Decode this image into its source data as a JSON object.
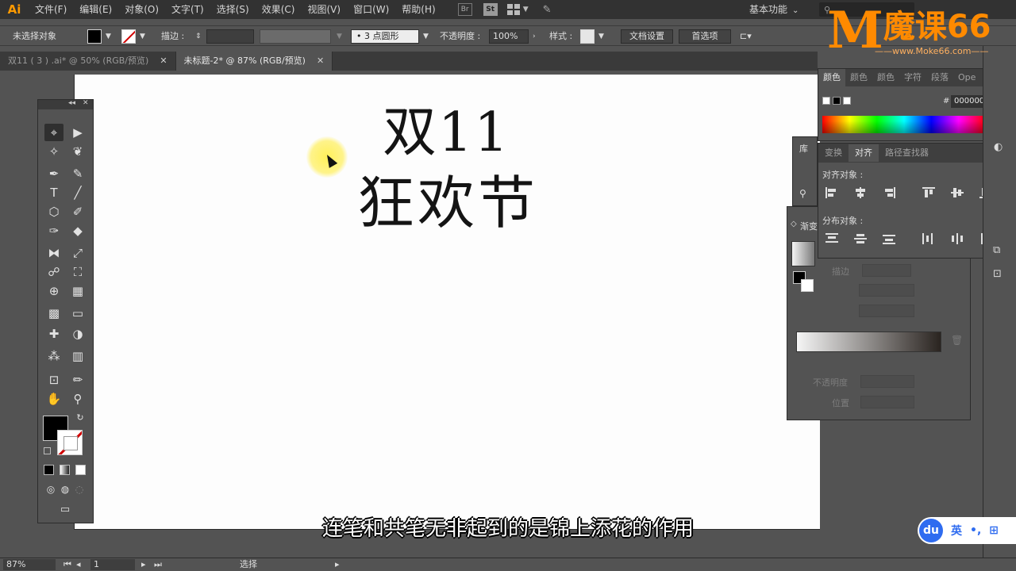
{
  "app": {
    "logo": "Ai",
    "menu": [
      "文件(F)",
      "编辑(E)",
      "对象(O)",
      "文字(T)",
      "选择(S)",
      "效果(C)",
      "视图(V)",
      "窗口(W)",
      "帮助(H)"
    ],
    "br_label": "Br",
    "st_label": "St",
    "workspace": "基本功能"
  },
  "control": {
    "selection_status": "未选择对象",
    "stroke_label": "描边 :",
    "brush_value": "3 点圆形",
    "opacity_label": "不透明度 :",
    "opacity_value": "100%",
    "style_label": "样式 :",
    "doc_setup": "文档设置",
    "preferences": "首选项"
  },
  "tabs": [
    {
      "label": "双11 ( 3 ) .ai* @ 50% (RGB/预览)",
      "active": false
    },
    {
      "label": "未标题-2* @ 87% (RGB/预览)",
      "active": true
    }
  ],
  "canvas": {
    "line1": "双11",
    "line2": "狂欢节"
  },
  "color_panel": {
    "tabs": [
      "颜色",
      "颜色",
      "颜色",
      "字符",
      "段落",
      "Ope"
    ],
    "hex_prefix": "#",
    "hex": "000000"
  },
  "align_panel": {
    "tabs": [
      "变换",
      "对齐",
      "路径查找器"
    ],
    "align_objects": "对齐对象 :",
    "distribute_objects": "分布对象 :"
  },
  "library_tab": "库",
  "gradient_panel": {
    "title": "渐变",
    "stroke_label": "描边",
    "opacity_label": "不透明度",
    "position_label": "位置"
  },
  "watermark": {
    "m": "M",
    "brand": "魔课66",
    "url": "——www.Moke66.com——"
  },
  "subtitle": "连笔和共笔无非起到的是锦上添花的作用",
  "ime": {
    "logo": "du",
    "lang": "英",
    "punct": "•,",
    "box": "⊞"
  },
  "status": {
    "zoom": "87%",
    "page": "1",
    "tool": "选择"
  },
  "colors": {
    "accent_logo": "#ff9a00",
    "watermark": "#ff8a00",
    "ime_blue": "#2f6cf0"
  }
}
